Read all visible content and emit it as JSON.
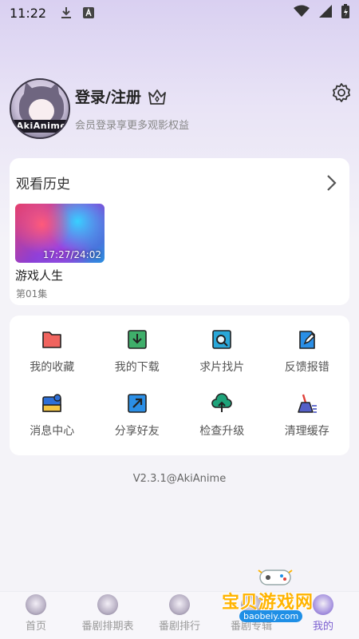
{
  "status_bar": {
    "time": "11:22"
  },
  "profile": {
    "avatar_text": "AkiAnime",
    "login_title": "登录/注册",
    "login_subtitle": "会员登录享更多观影权益"
  },
  "history": {
    "title": "观看历史",
    "items": [
      {
        "title": "游戏人生",
        "episode": "第01集",
        "progress": "17:27/24:02"
      }
    ]
  },
  "menu": {
    "items": [
      {
        "label": "我的收藏",
        "icon": "folder-icon",
        "color": "#f0645f"
      },
      {
        "label": "我的下载",
        "icon": "download-icon",
        "color": "#3fae6a"
      },
      {
        "label": "求片找片",
        "icon": "search-doc-icon",
        "color": "#29a7d8"
      },
      {
        "label": "反馈报错",
        "icon": "edit-doc-icon",
        "color": "#2b8fe6"
      },
      {
        "label": "消息中心",
        "icon": "message-icon",
        "color": "#2e6fd6"
      },
      {
        "label": "分享好友",
        "icon": "share-icon",
        "color": "#2b8fe6"
      },
      {
        "label": "检查升级",
        "icon": "cloud-upload-icon",
        "color": "#1ea37a"
      },
      {
        "label": "清理缓存",
        "icon": "broom-icon",
        "color": "#5560c8"
      }
    ]
  },
  "version": "V2.3.1@AkiAnime",
  "bottom_nav": {
    "items": [
      {
        "label": "首页"
      },
      {
        "label": "番剧排期表"
      },
      {
        "label": "番剧排行"
      },
      {
        "label": "番剧专辑"
      },
      {
        "label": "我的"
      }
    ],
    "active_index": 4
  },
  "watermark": {
    "text": "宝贝游戏网",
    "url": "baobeiy.com"
  },
  "colors": {
    "accent": "#7b5fd0",
    "header_gradient_top": "#d9d0f1"
  }
}
